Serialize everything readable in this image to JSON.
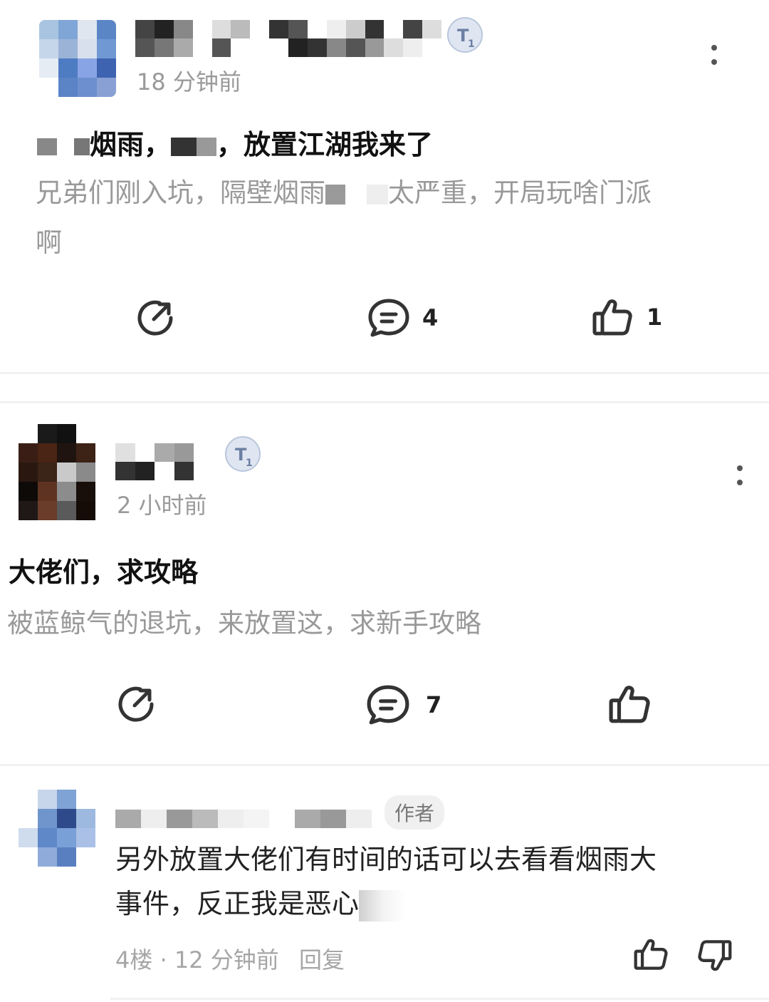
{
  "posts": [
    {
      "time": "18 分钟前",
      "title_prefix": "烟雨，",
      "title_suffix": "，放置江湖我来了",
      "body_part1": "兄弟们刚入坑，隔壁烟雨",
      "body_part2": "太严重，开局玩啥门派",
      "body_part3": "啊",
      "comment_count": "4",
      "like_count": "1"
    },
    {
      "time": "2 小时前",
      "title": "大佬们，求攻略",
      "body": "被蓝鲸气的退坑，来放置这，求新手攻略",
      "comment_count": "7",
      "like_count": ""
    }
  ],
  "reply": {
    "author_tag": "作者",
    "text_line1": "另外放置大佬们有时间的话可以去看看烟雨大",
    "text_line2": "事件，反正我是恶心",
    "floor": "4楼",
    "separator": "·",
    "time": "12 分钟前",
    "reply_label": "回复"
  },
  "icons": {
    "share": "share-icon",
    "comment": "comment-icon",
    "like": "thumbs-up-icon",
    "dislike": "thumbs-down-icon",
    "more": "more-vertical-icon",
    "level_badge": "level-badge-icon"
  },
  "colors": {
    "text_primary": "#111111",
    "text_secondary": "#999999",
    "icon": "#333333",
    "divider": "#f1f1f1",
    "badge": "#dfe6f2"
  }
}
